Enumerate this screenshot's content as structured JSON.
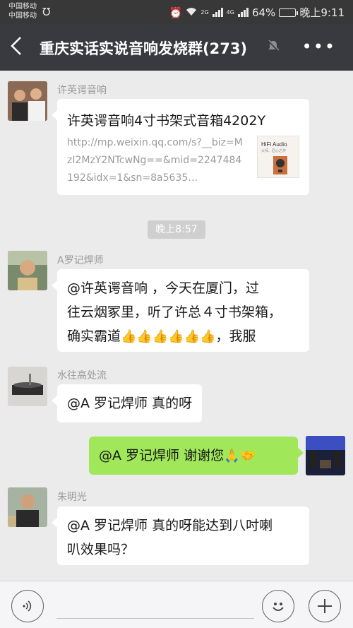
{
  "status": {
    "carrier1": "中国移动",
    "carrier2": "中国移动",
    "battery_pct": "64%",
    "battery_level": 0.64,
    "time": "晚上9:11",
    "net_tag1": "2G",
    "net_tag2": "4G"
  },
  "header": {
    "back_icon": "back-chevron-icon",
    "title": "重庆实话实说音响发烧群(273)",
    "mute_icon": "bell-mute-icon",
    "more_icon": "more-dots-icon"
  },
  "messages": {
    "m1": {
      "sender": "许英谔音响",
      "card_title": "许英谔音响4寸书架式音箱4202Y",
      "card_url": "http://mp.weixin.qq.com/s?__biz=MzI2MzY2NTcwNg==&mid=2247484192&idx=1&sn=8a5635…",
      "thumb_text1": "HiFi Audio",
      "thumb_text2": "大师、匠心之作"
    },
    "timestamp": "晚上8:57",
    "m2": {
      "sender": "A罗记焊师",
      "text_line1": "@许英谔音响 ，今天在厦门，过",
      "text_line2": "往云烟冢里，听了许总４寸书架箱，",
      "text_prefix": "确实霸道",
      "emojis": "👍👍👍👍👍👍",
      "text_suffix": "，我服"
    },
    "m3": {
      "sender": "水往高处流",
      "text": "@A 罗记焊师  真的呀"
    },
    "m4": {
      "text": "@A 罗记焊师  谢谢您",
      "emojis": "🙏🤝"
    },
    "m5": {
      "sender": "朱明光",
      "text_line1": "@A 罗记焊师  真的呀能达到八吋喇",
      "text_line2": "叭效果吗？"
    }
  },
  "inputbar": {
    "voice_icon": "voice-icon",
    "emoji_icon": "emoji-smile-icon",
    "plus_icon": "plus-icon"
  },
  "colors": {
    "status_bg": "#383838",
    "title_bg": "#393a3f",
    "chat_bg": "#ebebeb",
    "self_bubble": "#a0e75a",
    "other_bubble": "#ffffff"
  }
}
